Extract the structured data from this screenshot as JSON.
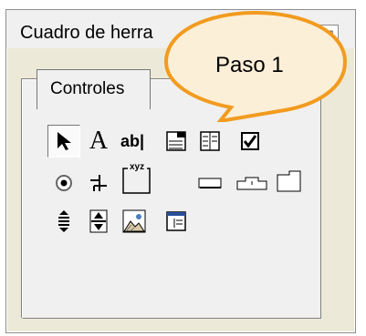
{
  "window": {
    "title": "Cuadro de herra",
    "close_glyph": "⊠"
  },
  "tab": {
    "label": "Controles"
  },
  "callout": {
    "text": "Paso 1",
    "fill": "#fcefd8",
    "stroke": "#f29b1f"
  },
  "tools": [
    {
      "name": "pointer-tool-icon"
    },
    {
      "name": "label-tool-icon",
      "glyph": "A"
    },
    {
      "name": "textbox-tool-icon",
      "glyph": "ab|"
    },
    {
      "name": "combobox-tool-icon"
    },
    {
      "name": "listbox-tool-icon"
    },
    {
      "name": "checkbox-tool-icon"
    },
    {
      "name": "option-button-tool-icon"
    },
    {
      "name": "toggle-button-tool-icon"
    },
    {
      "name": "frame-tool-icon",
      "glyph": "xyz"
    },
    {
      "name": "command-button-tool-icon"
    },
    {
      "name": "tabstrip-tool-icon"
    },
    {
      "name": "multipage-tool-icon"
    },
    {
      "name": "scrollbar-tool-icon"
    },
    {
      "name": "spinbutton-tool-icon"
    },
    {
      "name": "image-tool-icon"
    },
    {
      "name": "refedit-tool-icon"
    }
  ]
}
